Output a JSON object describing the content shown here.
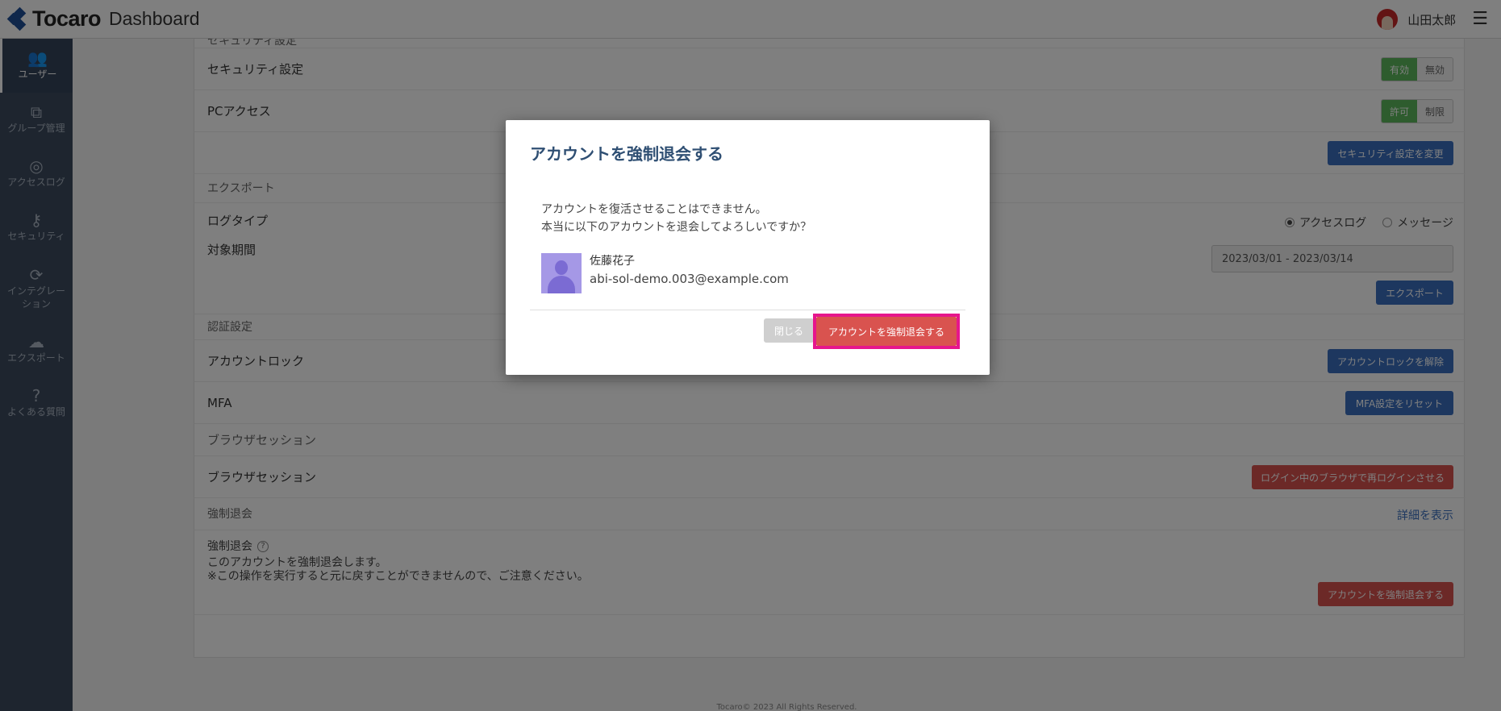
{
  "header": {
    "brand": "Tocaro",
    "title": "Dashboard",
    "user_name": "山田太郎",
    "menu_glyph": "☰"
  },
  "sidebar": {
    "items": [
      {
        "label": "ユーザー",
        "icon": "users-icon",
        "glyph": "👥"
      },
      {
        "label": "グループ管理",
        "icon": "sitemap-icon",
        "glyph": "⧉"
      },
      {
        "label": "アクセスログ",
        "icon": "target-icon",
        "glyph": "◎"
      },
      {
        "label": "セキュリティ",
        "icon": "key-icon",
        "glyph": "⚷"
      },
      {
        "label": "インテグレーション",
        "label_line1": "インテグレー",
        "label_line2": "ション",
        "icon": "sync-icon",
        "glyph": "⟳"
      },
      {
        "label": "エクスポート",
        "icon": "cloud-download-icon",
        "glyph": "☁"
      },
      {
        "label": "よくある質問",
        "icon": "question-icon",
        "glyph": "?"
      }
    ]
  },
  "main": {
    "security_section": "セキュリティ設定",
    "security_setting": {
      "label": "セキュリティ設定",
      "on": "有効",
      "off": "無効"
    },
    "pc_access": {
      "label": "PCアクセス",
      "on": "許可",
      "off": "制限"
    },
    "change_security_button": "セキュリティ設定を変更",
    "export_section": "エクスポート",
    "log_type": {
      "label": "ログタイプ",
      "options": [
        "アクセスログ",
        "メッセージ"
      ],
      "selected": "アクセスログ"
    },
    "period": {
      "label": "対象期間",
      "value": "2023/03/01 - 2023/03/14"
    },
    "export_button": "エクスポート",
    "auth_section": "認証設定",
    "account_lock": {
      "label": "アカウントロック",
      "button": "アカウントロックを解除"
    },
    "mfa": {
      "label": "MFA",
      "button": "MFA設定をリセット"
    },
    "browser_section": "ブラウザセッション",
    "browser_session": {
      "label": "ブラウザセッション",
      "button": "ログイン中のブラウザで再ログインさせる"
    },
    "withdraw_section": "強制退会",
    "show_details_link": "詳細を表示",
    "withdraw": {
      "label": "強制退会",
      "help_glyph": "?",
      "note1": "このアカウントを強制退会します。",
      "note2": "※この操作を実行すると元に戻すことができませんので、ご注意ください。",
      "button": "アカウントを強制退会する"
    },
    "footer": "Tocaro© 2023 All Rights Reserved."
  },
  "modal": {
    "title": "アカウントを強制退会する",
    "message_line1": "アカウントを復活させることはできません。",
    "message_line2": "本当に以下のアカウントを退会してよろしいですか？",
    "user": {
      "name": "佐藤花子",
      "email": "abi-sol-demo.003@example.com"
    },
    "close_button": "閉じる",
    "confirm_button": "アカウントを強制退会する",
    "highlight_color": "#e6168c"
  },
  "colors": {
    "primary": "#3a6fbf",
    "danger": "#d9534f",
    "success": "#5cb85c",
    "sidebar": "#3c4b5e",
    "title": "#2f4f73"
  }
}
